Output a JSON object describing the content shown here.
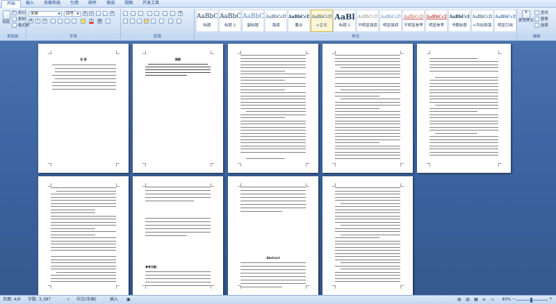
{
  "tabs": [
    "开始",
    "插入",
    "页面布局",
    "引用",
    "邮件",
    "审阅",
    "视图",
    "开发工具"
  ],
  "clipboard": {
    "paste": "粘贴",
    "cut": "剪切",
    "copy": "复制",
    "format_painter": "格式刷",
    "label": "剪贴板"
  },
  "font": {
    "name": "宋体",
    "size": "四号",
    "label": "字体"
  },
  "paragraph": {
    "label": "段落"
  },
  "styles": {
    "label": "样式",
    "items": [
      {
        "sample": "AaBbC",
        "name": "标题"
      },
      {
        "sample": "AaBbC",
        "name": "标题 2"
      },
      {
        "sample": "AaBbC",
        "name": "副标题"
      },
      {
        "sample": "AaBbCcD",
        "name": "强调"
      },
      {
        "sample": "AaBbCcD",
        "name": "要点"
      },
      {
        "sample": "AaBbCcD",
        "name": "↵正文"
      },
      {
        "sample": "AaBl",
        "name": "标题 1"
      },
      {
        "sample": "AaBbCcD",
        "name": "不明显强调"
      },
      {
        "sample": "AaBbCcD",
        "name": "明显强调"
      },
      {
        "sample": "AaBbCcD",
        "name": "不明显参考"
      },
      {
        "sample": "AaBbCcD",
        "name": "明显参考"
      },
      {
        "sample": "AaBbCcI",
        "name": "书籍标题"
      },
      {
        "sample": "AaBbCcD",
        "name": "↵列出段落"
      },
      {
        "sample": "AaBbCcD",
        "name": "明显引用"
      }
    ],
    "change_styles": "更改样式"
  },
  "editing": {
    "find": "查找",
    "replace": "替换",
    "select": "选择",
    "label": "编辑"
  },
  "pages": {
    "toc_title": "目  录",
    "abstract_title": "摘要",
    "references_title": "参考文献：",
    "english_abstract_title": "Abstract"
  },
  "status": {
    "page": "页面: 4/9",
    "words": "字数: 3,387",
    "language": "中文(中国)",
    "insert": "插入",
    "zoom": "40%"
  }
}
